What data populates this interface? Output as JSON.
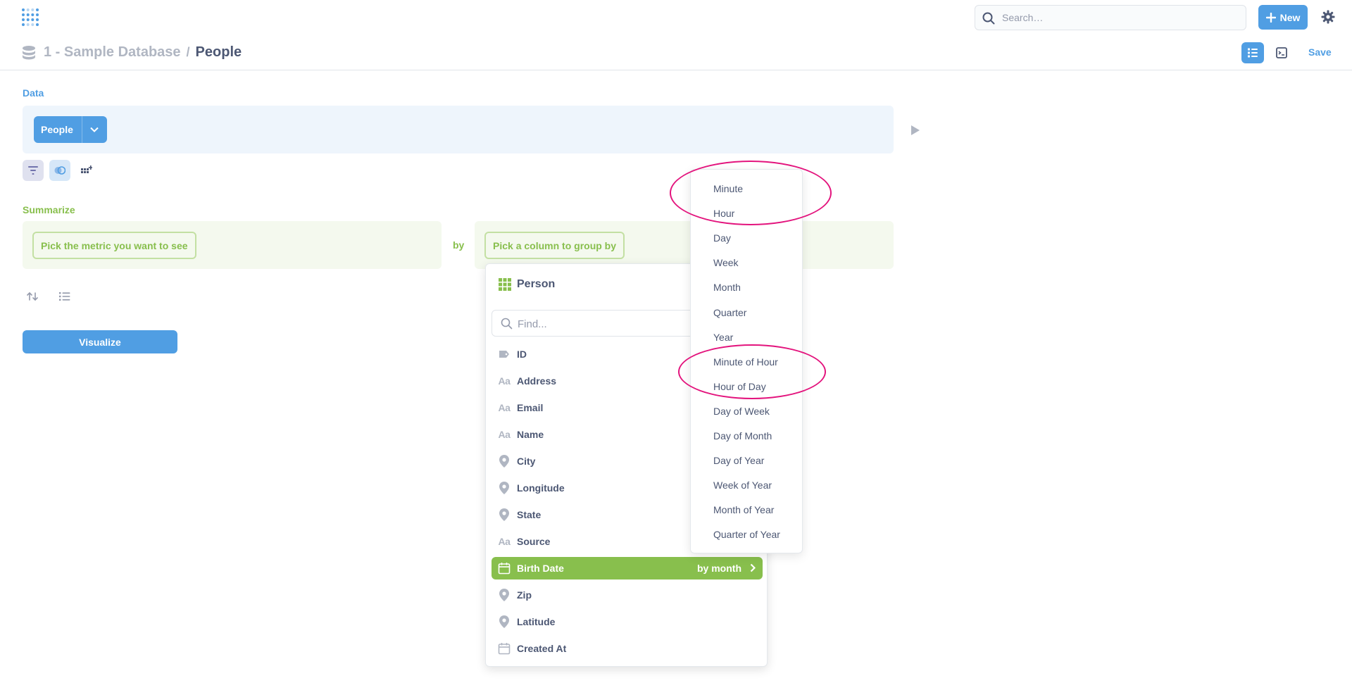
{
  "nav": {
    "search_placeholder": "Search…",
    "new_label": "New"
  },
  "header": {
    "database": "1 - Sample Database",
    "separator": "/",
    "table": "People",
    "save_label": "Save"
  },
  "data_section": {
    "label": "Data",
    "table_pill": "People"
  },
  "summarize": {
    "label": "Summarize",
    "metric_placeholder": "Pick the metric you want to see",
    "by_label": "by",
    "group_placeholder": "Pick a column to group by"
  },
  "visualize_label": "Visualize",
  "column_picker": {
    "table_name": "Person",
    "find_placeholder": "Find...",
    "columns": [
      {
        "label": "ID",
        "icon": "label-icon"
      },
      {
        "label": "Address",
        "icon": "text-icon"
      },
      {
        "label": "Email",
        "icon": "text-icon"
      },
      {
        "label": "Name",
        "icon": "text-icon"
      },
      {
        "label": "City",
        "icon": "location-icon"
      },
      {
        "label": "Longitude",
        "icon": "location-icon"
      },
      {
        "label": "State",
        "icon": "location-icon"
      },
      {
        "label": "Source",
        "icon": "text-icon"
      },
      {
        "label": "Birth Date",
        "icon": "calendar-icon",
        "selected": true,
        "bucket": "by month"
      },
      {
        "label": "Zip",
        "icon": "location-icon"
      },
      {
        "label": "Latitude",
        "icon": "location-icon"
      },
      {
        "label": "Created At",
        "icon": "calendar-icon"
      }
    ]
  },
  "temporal_units": [
    "Minute",
    "Hour",
    "Day",
    "Week",
    "Month",
    "Quarter",
    "Year",
    "Minute of Hour",
    "Hour of Day",
    "Day of Week",
    "Day of Month",
    "Day of Year",
    "Week of Year",
    "Month of Year",
    "Quarter of Year"
  ],
  "colors": {
    "brand": "#509ee3",
    "summarize": "#88bf4d",
    "annotation": "#e3147d"
  }
}
